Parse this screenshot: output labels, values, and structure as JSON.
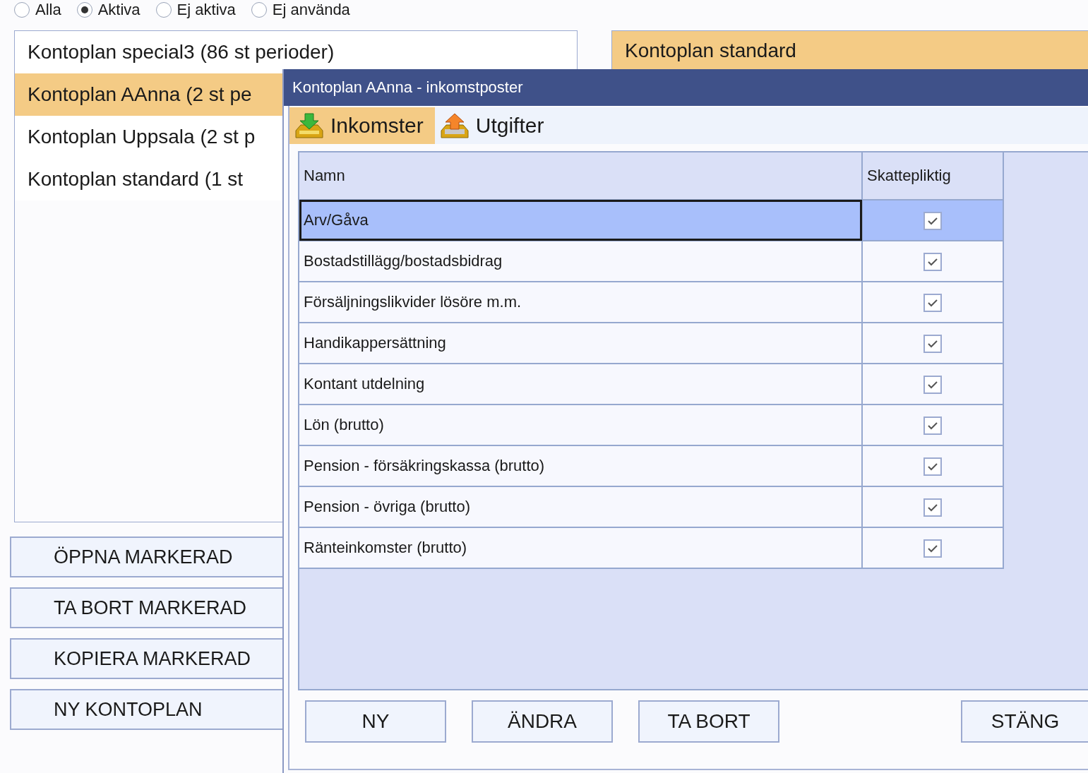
{
  "filter": [
    {
      "label": "Alla",
      "selected": false
    },
    {
      "label": "Aktiva",
      "selected": true
    },
    {
      "label": "Ej aktiva",
      "selected": false
    },
    {
      "label": "Ej använda",
      "selected": false
    }
  ],
  "plans": [
    {
      "label": "Kontoplan special3 (86 st perioder)",
      "selected": false
    },
    {
      "label": "Kontoplan AAnna (2 st pe",
      "selected": true
    },
    {
      "label": "Kontoplan Uppsala (2 st p",
      "selected": false
    },
    {
      "label": "Kontoplan standard (1 st",
      "selected": false
    }
  ],
  "plan_buttons": [
    "ÖPPNA MARKERAD",
    "TA BORT MARKERAD",
    "KOPIERA MARKERAD",
    "NY KONTOPLAN"
  ],
  "detail_panel": {
    "title": "Kontoplan standard"
  },
  "dialog": {
    "title": "Kontoplan AAnna - inkomstposter",
    "tabs": [
      {
        "label": "Inkomster",
        "kind": "income",
        "selected": true
      },
      {
        "label": "Utgifter",
        "kind": "expense",
        "selected": false
      }
    ],
    "table": {
      "columns": [
        "Namn",
        "Skattepliktig"
      ],
      "rows": [
        {
          "name": "Arv/Gåva",
          "taxable": true,
          "selected": true
        },
        {
          "name": "Bostadstillägg/bostadsbidrag",
          "taxable": true,
          "selected": false
        },
        {
          "name": "Försäljningslikvider lösöre m.m.",
          "taxable": true,
          "selected": false
        },
        {
          "name": "Handikappersättning",
          "taxable": true,
          "selected": false
        },
        {
          "name": "Kontant utdelning",
          "taxable": true,
          "selected": false
        },
        {
          "name": "Lön (brutto)",
          "taxable": true,
          "selected": false
        },
        {
          "name": "Pension - försäkringskassa (brutto)",
          "taxable": true,
          "selected": false
        },
        {
          "name": "Pension - övriga (brutto)",
          "taxable": true,
          "selected": false
        },
        {
          "name": "Ränteinkomster (brutto)",
          "taxable": true,
          "selected": false
        }
      ]
    },
    "buttons": [
      "NY",
      "ÄNDRA",
      "TA BORT"
    ],
    "close_button": "STÄNG"
  }
}
